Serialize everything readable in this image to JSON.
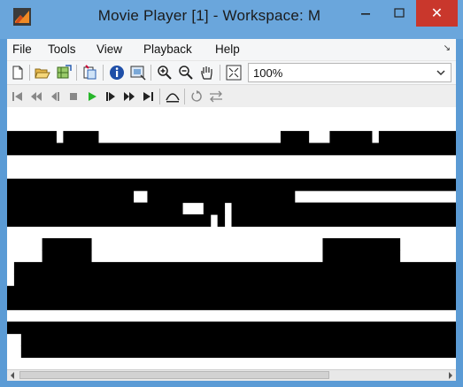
{
  "window": {
    "title": "Movie Player [1] - Workspace: M",
    "minimize_glyph": "–",
    "maximize_glyph": "☐",
    "close_glyph": "✕",
    "accent": "#6aa6dc",
    "close_color": "#c9372c"
  },
  "menu": {
    "items": [
      "File",
      "Tools",
      "View",
      "Playback",
      "Help"
    ],
    "overflow_icon": "dock-arrow-icon"
  },
  "toolbar": {
    "icons": [
      "new-figure-icon",
      "open-icon",
      "export-icon",
      "copy-figure-icon",
      "info-icon",
      "frame-size-icon",
      "zoom-in-icon",
      "zoom-out-icon",
      "pan-hand-icon",
      "fit-to-window-icon"
    ],
    "zoom_value": "100%"
  },
  "playback_toolbar": {
    "icons": [
      "goto-first-icon",
      "rewind-icon",
      "step-back-icon",
      "stop-icon",
      "play-icon",
      "step-forward-icon",
      "fast-forward-icon",
      "goto-last-icon",
      "jump-to-icon",
      "repeat-icon",
      "forward-backward-icon"
    ]
  },
  "frame": {
    "grid_rows": [
      "0000000000000000000000000000000000000000000000000000000000000000",
      "0000000000000000000000000000000000000000000000000000000000000000",
      "1111111011111000000000000000000000000001111000111111011111111111",
      "1111111111111111111111111111111111111111111111111111111111111111",
      "0000000000000000000000000000000000000000000000000000000000000000",
      "0000000000000000000000000000000000000000000000000000000000000000",
      "1111111111111111111111111111111111111111111111111111111111111111",
      "1111111111111111110011111111111111111111100000000000000000000000",
      "1111111111111111111111111000111011111111111111111111111111111111",
      "1111111111111111111111111111101011111111111111111111111111111111",
      "0000000000000000000000000000000000000000000000000000000000000000",
      "0000011111110000000000000000000000000000000001111111111100000000",
      "0000011111110000000000000000000000000000000001111111111100000000",
      "0111111111111111111111111111111111111111111111111111111111111111",
      "0111111111111111111111111111111111111111111111111111111111111111",
      "1111111111111111111111111111111111111111111111111111111111111111",
      "1111111111111111111111111111111111111111111111111111111111111111",
      "0000000000000000000000000000000000000000000000000000000000000000",
      "1111111111111111111111111111111111111111111111111111111111111111",
      "0011111111111111111111111111111111111111111111111111111111111111",
      "0011111111111111111111111111111111111111111111111111111111111111",
      "0000000000000000000000000000000000000000000000000000000000000000"
    ]
  }
}
